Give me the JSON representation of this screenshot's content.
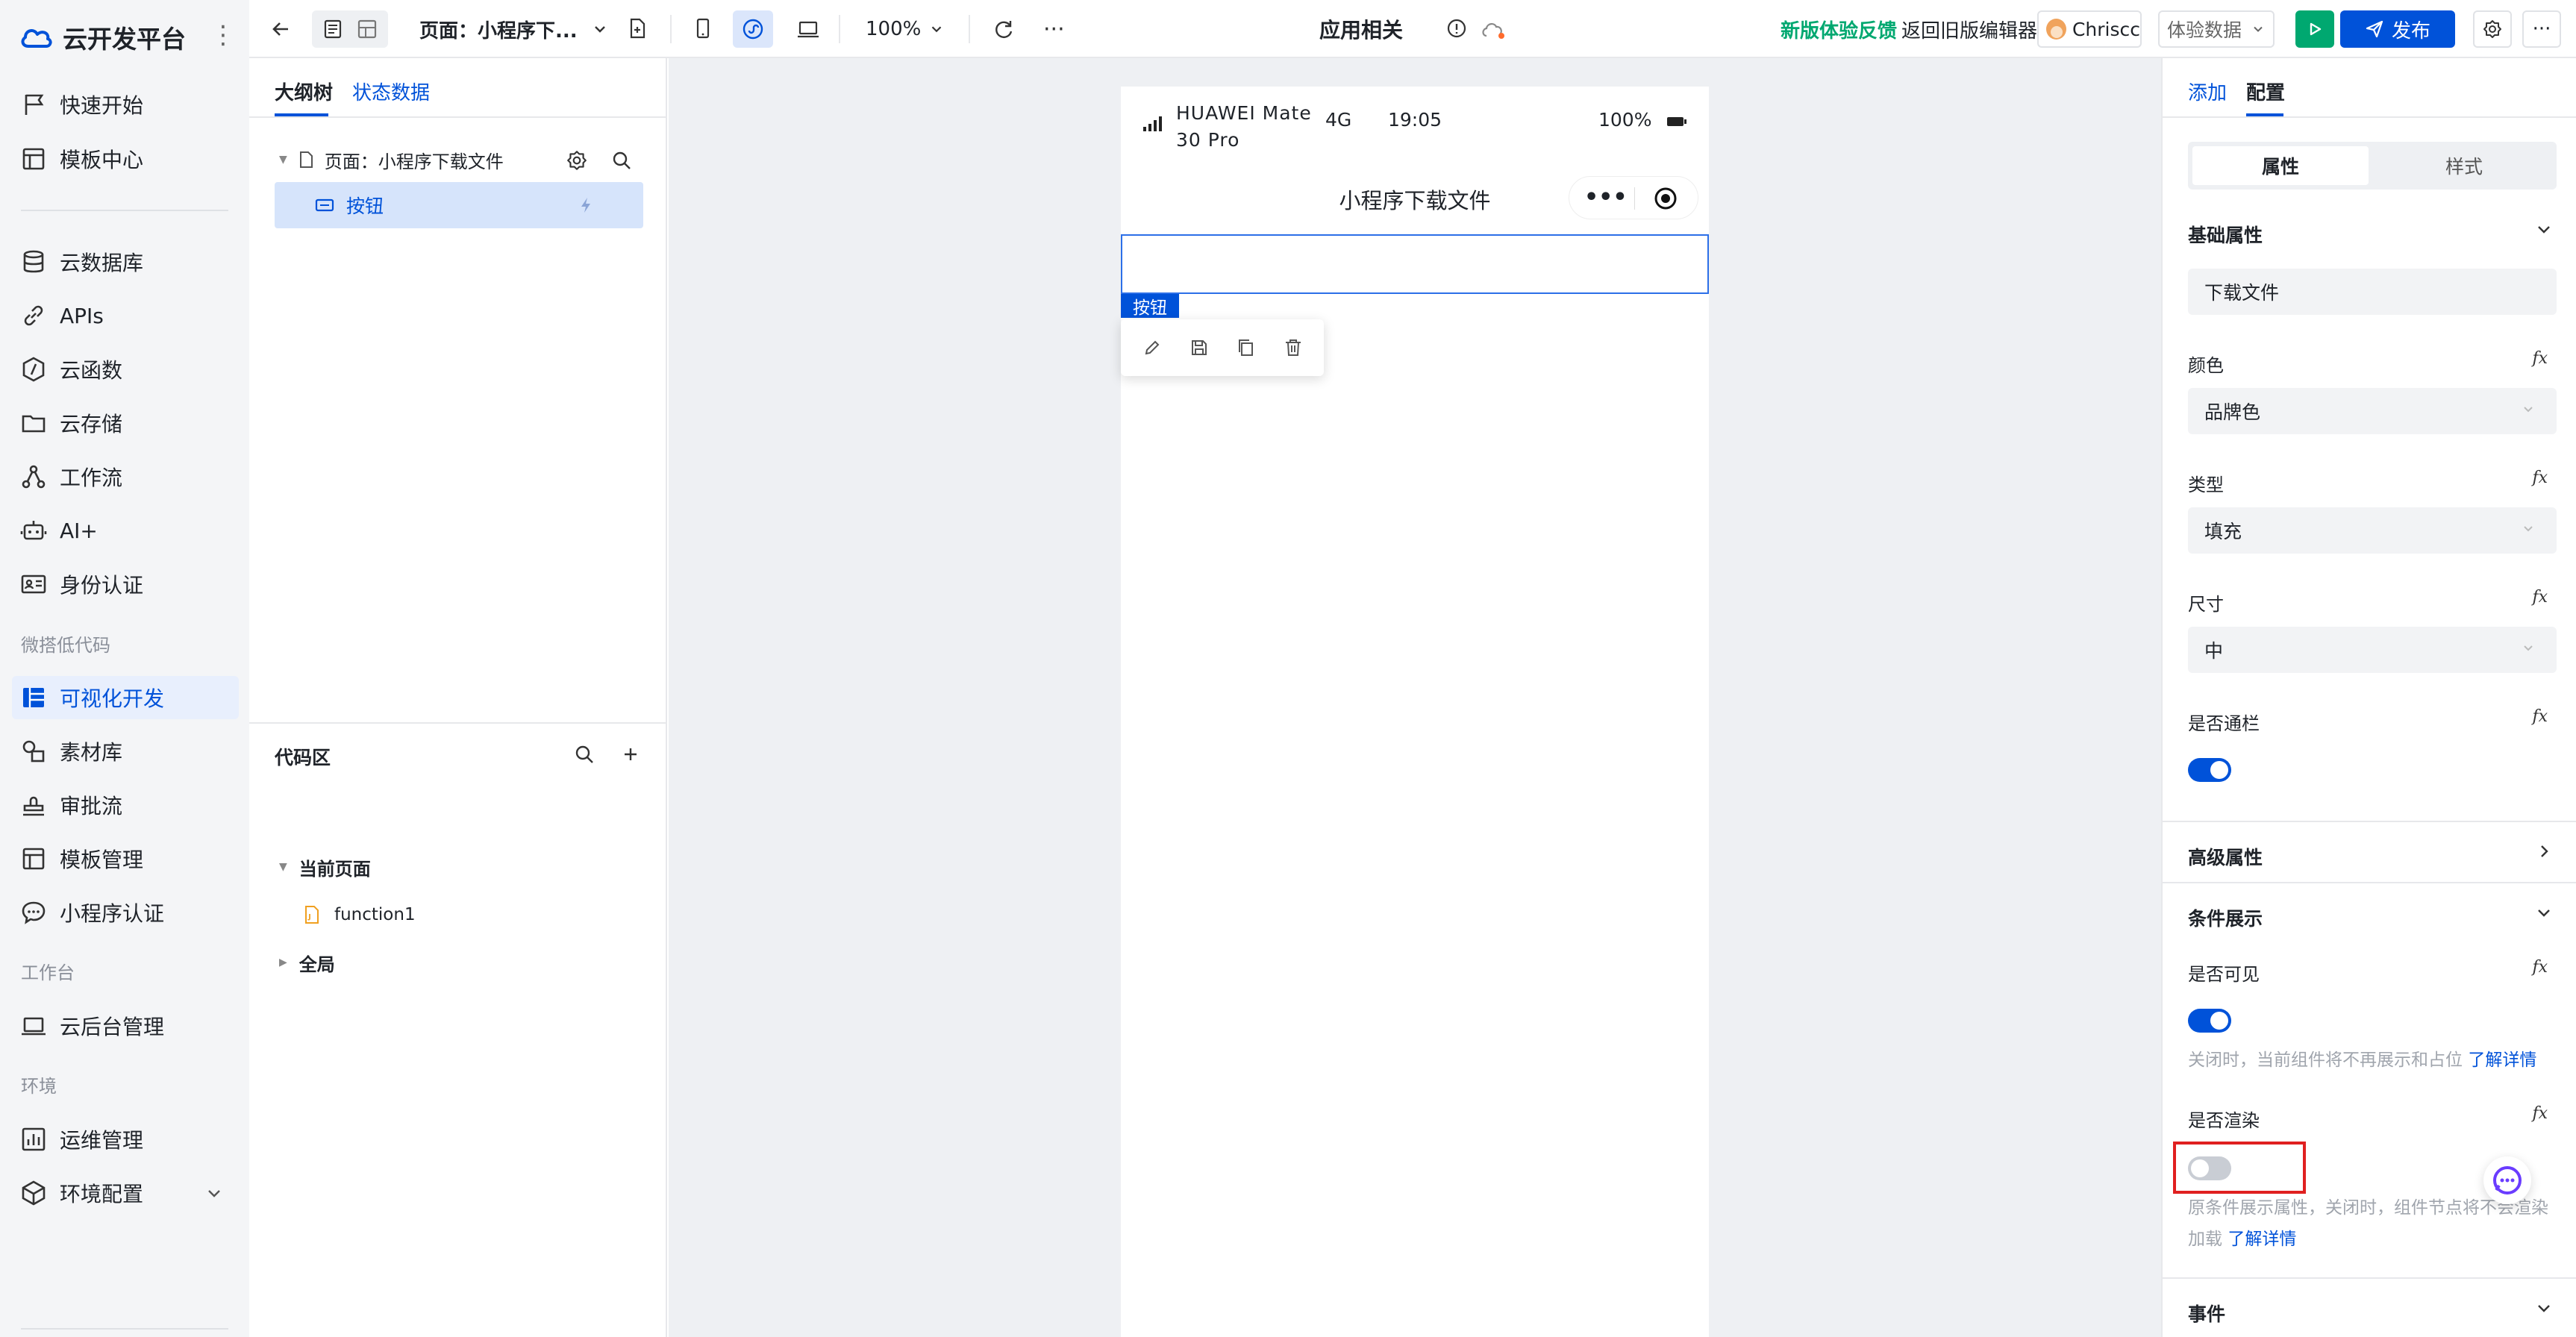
{
  "app": {
    "title": "云开发平台"
  },
  "nav": {
    "items": [
      {
        "label": "快速开始",
        "icon": "flag-icon"
      },
      {
        "label": "模板中心",
        "icon": "template-icon"
      },
      {
        "label": "云数据库",
        "icon": "database-icon"
      },
      {
        "label": "APIs",
        "icon": "link-icon"
      },
      {
        "label": "云函数",
        "icon": "function-icon"
      },
      {
        "label": "云存储",
        "icon": "storage-icon"
      },
      {
        "label": "工作流",
        "icon": "workflow-icon"
      },
      {
        "label": "AI+",
        "icon": "robot-icon"
      },
      {
        "label": "身份认证",
        "icon": "id-card-icon"
      },
      {
        "label": "可视化开发",
        "icon": "layout-icon"
      },
      {
        "label": "素材库",
        "icon": "shapes-icon"
      },
      {
        "label": "审批流",
        "icon": "stamp-icon"
      },
      {
        "label": "模板管理",
        "icon": "template-icon"
      },
      {
        "label": "小程序认证",
        "icon": "chat-icon"
      },
      {
        "label": "云后台管理",
        "icon": "laptop-icon"
      },
      {
        "label": "运维管理",
        "icon": "chart-icon"
      },
      {
        "label": "环境配置",
        "icon": "cube-icon"
      }
    ],
    "sections": [
      "微搭低代码",
      "工作台",
      "环境"
    ],
    "active_index": 9
  },
  "toolbar": {
    "page_selector": "页面：小程序下...",
    "zoom": "100%",
    "center_title": "应用相关",
    "feedback": "新版体验反馈",
    "old_editor": "返回旧版编辑器",
    "user": "Chriscc",
    "experience_data": "体验数据",
    "publish": "发布"
  },
  "outline": {
    "tabs": [
      "大纲树",
      "状态数据"
    ],
    "page_node": "页面：小程序下载文件",
    "button_node": "按钮",
    "code_title": "代码区",
    "current_page": "当前页面",
    "function_item": "function1",
    "global": "全局"
  },
  "phone": {
    "device": "HUAWEI Mate 30 Pro",
    "network": "4G",
    "time": "19:05",
    "battery": "100%",
    "nav_title": "小程序下载文件",
    "selected_tag": "按钮"
  },
  "config": {
    "tabs": [
      "添加",
      "配置"
    ],
    "segments": [
      "属性",
      "样式"
    ],
    "basic_title": "基础属性",
    "text_value": "下载文件",
    "color_label": "颜色",
    "color_value": "品牌色",
    "type_label": "类型",
    "type_value": "填充",
    "size_label": "尺寸",
    "size_value": "中",
    "block_label": "是否通栏",
    "block_on": true,
    "advanced_title": "高级属性",
    "condition_title": "条件展示",
    "visible_label": "是否可见",
    "visible_on": true,
    "visible_hint": "关闭时，当前组件将不再展示和占位",
    "learn_more": "了解详情",
    "render_label": "是否渲染",
    "render_on": false,
    "render_hint": "原条件展示属性，关闭时，组件节点将不会渲染加载",
    "events_title": "事件"
  },
  "colors": {
    "brand": "#0052d9",
    "active_bg": "#e8effd",
    "highlight_box": "#e02020",
    "feedback_green": "#00a870"
  }
}
